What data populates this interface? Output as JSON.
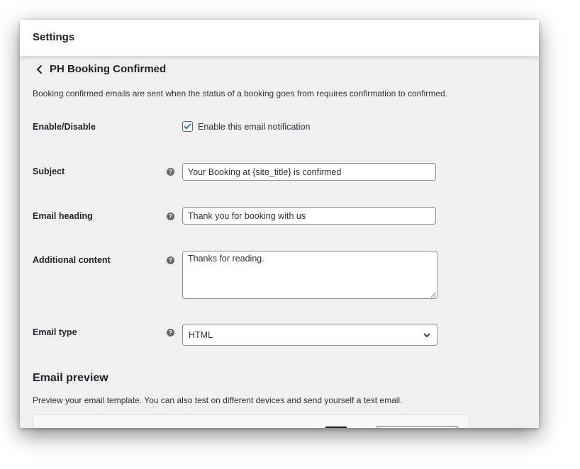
{
  "header": {
    "title": "Settings"
  },
  "page": {
    "title": "PH Booking Confirmed",
    "description": "Booking confirmed emails are sent when the status of a booking goes from requires confirmation to confirmed."
  },
  "fields": {
    "enable": {
      "label": "Enable/Disable",
      "checkbox_label": "Enable this email notification",
      "checked": true
    },
    "subject": {
      "label": "Subject",
      "value": "Your Booking at {site_title} is confirmed"
    },
    "heading": {
      "label": "Email heading",
      "value": "Thank you for booking with us"
    },
    "additional": {
      "label": "Additional content",
      "value": "Thanks for reading."
    },
    "type": {
      "label": "Email type",
      "value": "HTML"
    }
  },
  "preview": {
    "title": "Email preview",
    "description": "Preview your email template. You can also test on different devices and send yourself a test email."
  },
  "help_icon_glyph": "?",
  "colors": {
    "accent": "#2271b1",
    "background": "#f0f0f1"
  }
}
